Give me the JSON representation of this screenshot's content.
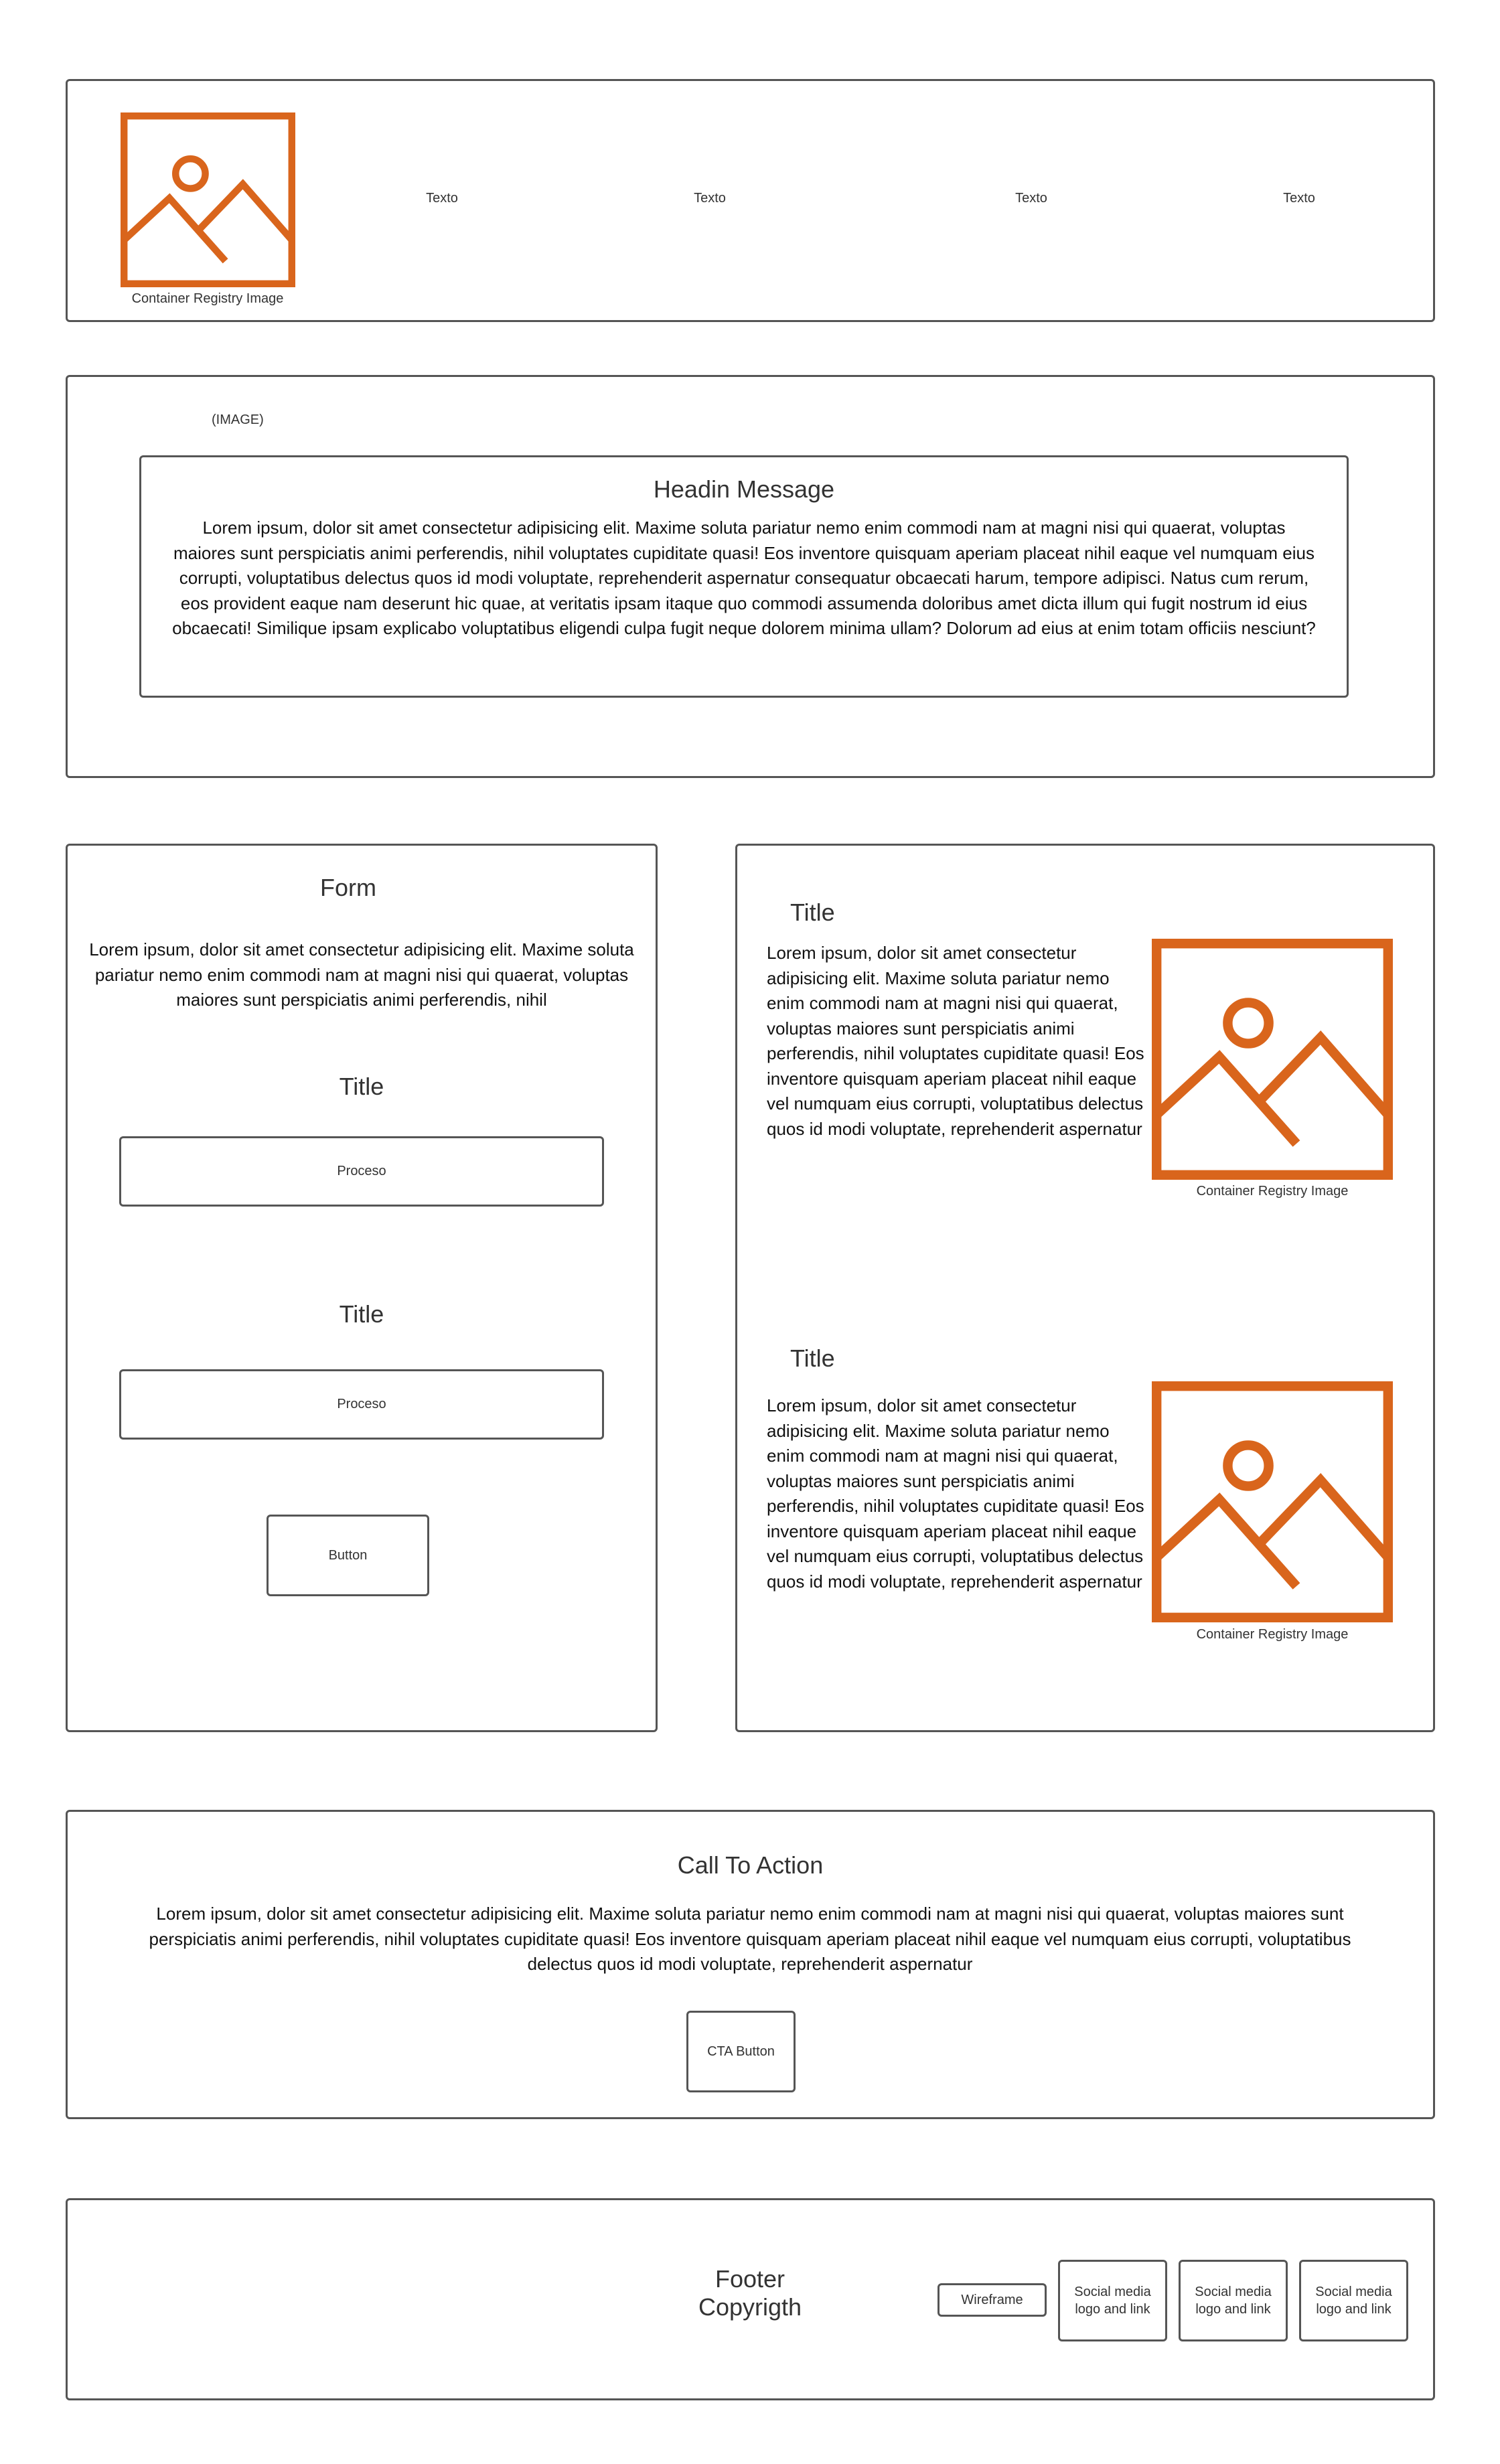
{
  "colors": {
    "accent": "#D9651C",
    "border": "#555555"
  },
  "header": {
    "logo_icon": "image-placeholder-icon",
    "logo_caption": "Container Registry Image",
    "nav": [
      "Texto",
      "Texto",
      "Texto",
      "Texto"
    ]
  },
  "hero": {
    "image_label": "(IMAGE)",
    "heading": "Headin Message",
    "body": "Lorem ipsum, dolor sit amet consectetur adipisicing elit. Maxime soluta pariatur nemo enim commodi nam at magni nisi qui quaerat, voluptas maiores sunt perspiciatis animi perferendis, nihil voluptates cupiditate quasi! Eos inventore quisquam aperiam placeat nihil eaque vel numquam eius corrupti, voluptatibus delectus quos id modi voluptate, reprehenderit aspernatur consequatur obcaecati harum, tempore adipisci. Natus cum rerum, eos provident eaque nam deserunt hic quae, at veritatis ipsam itaque quo commodi assumenda doloribus amet dicta illum qui fugit nostrum id eius obcaecati! Similique ipsam explicabo voluptatibus eligendi culpa fugit neque dolorem minima ullam? Dolorum ad eius at enim totam officiis nesciunt?"
  },
  "form": {
    "title": "Form",
    "body": "Lorem ipsum, dolor sit amet consectetur adipisicing elit. Maxime soluta pariatur nemo enim commodi nam at magni nisi qui quaerat, voluptas maiores sunt perspiciatis animi perferendis, nihil",
    "fields": [
      {
        "title": "Title",
        "value": "Proceso"
      },
      {
        "title": "Title",
        "value": "Proceso"
      }
    ],
    "button": "Button"
  },
  "features": [
    {
      "title": "Title",
      "body": "Lorem ipsum, dolor sit amet consectetur adipisicing elit. Maxime soluta pariatur nemo enim commodi nam at magni nisi qui quaerat, voluptas maiores sunt perspiciatis animi perferendis, nihil voluptates cupiditate quasi! Eos inventore quisquam aperiam placeat nihil eaque vel numquam eius corrupti, voluptatibus delectus quos id modi voluptate, reprehenderit aspernatur",
      "image_caption": "Container Registry Image"
    },
    {
      "title": "Title",
      "body": "Lorem ipsum, dolor sit amet consectetur adipisicing elit. Maxime soluta pariatur nemo enim commodi nam at magni nisi qui quaerat, voluptas maiores sunt perspiciatis animi perferendis, nihil voluptates cupiditate quasi! Eos inventore quisquam aperiam placeat nihil eaque vel numquam eius corrupti, voluptatibus delectus quos id modi voluptate, reprehenderit aspernatur",
      "image_caption": "Container Registry Image"
    }
  ],
  "cta": {
    "title": "Call To Action",
    "body": "Lorem ipsum, dolor sit amet consectetur adipisicing elit. Maxime soluta pariatur nemo enim commodi nam at magni nisi qui quaerat, voluptas maiores sunt perspiciatis animi perferendis, nihil voluptates cupiditate quasi! Eos inventore quisquam aperiam placeat nihil eaque vel numquam eius corrupti, voluptatibus delectus quos id modi voluptate, reprehenderit aspernatur",
    "button": "CTA Button"
  },
  "footer": {
    "title": "Footer",
    "copyright": "Copyrigth",
    "wireframe_button": "Wireframe",
    "social": [
      "Social media logo and link",
      "Social media logo and link",
      "Social media logo and link"
    ]
  }
}
